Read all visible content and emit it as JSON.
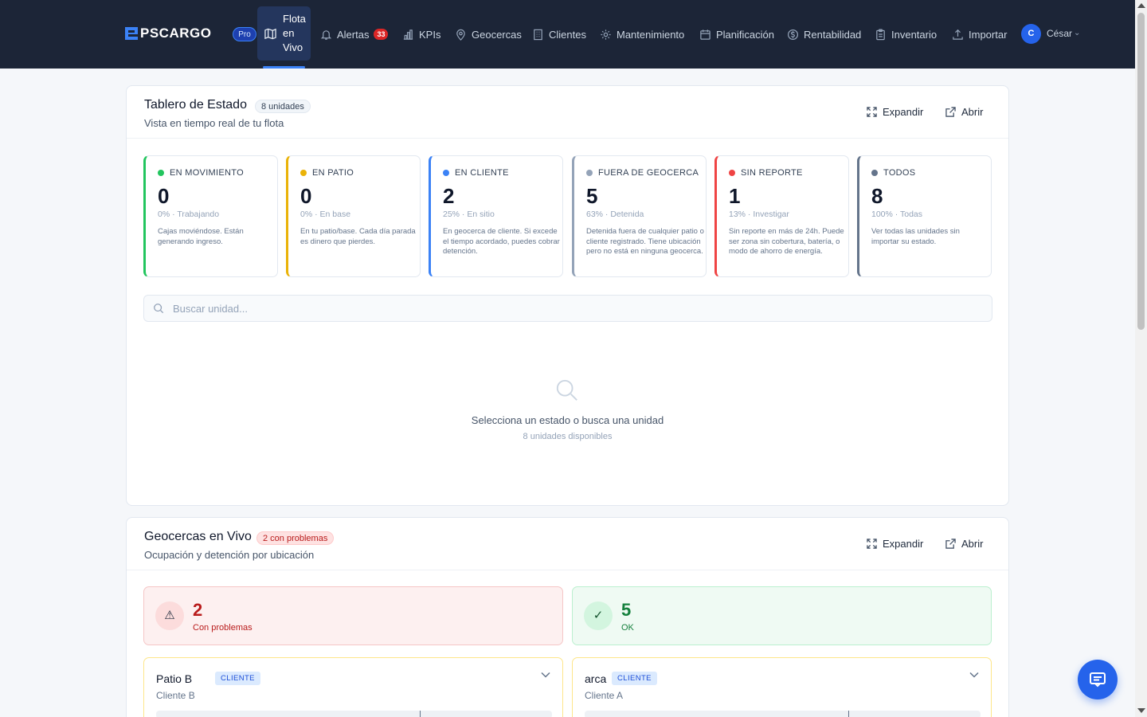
{
  "nav": {
    "logo": "PSCARGO",
    "plan_badge": "Pro",
    "active_item": "Flota en Vivo",
    "active_item_lines": [
      "Flota",
      "en",
      "Vivo"
    ],
    "items": [
      {
        "label": "Alertas",
        "icon": "bell-icon",
        "badge": "33"
      },
      {
        "label": "KPIs",
        "icon": "bar-chart-icon"
      },
      {
        "label": "Geocercas",
        "icon": "map-pin-icon"
      },
      {
        "label": "Clientes",
        "icon": "building-icon"
      },
      {
        "label": "Mantenimiento",
        "icon": "gear-icon"
      },
      {
        "label": "Planificación",
        "icon": "calendar-icon"
      },
      {
        "label": "Rentabilidad",
        "icon": "dollar-icon"
      },
      {
        "label": "Inventario",
        "icon": "clipboard-icon"
      },
      {
        "label": "Importar",
        "icon": "upload-icon"
      }
    ],
    "user": {
      "initial": "C",
      "name": "César"
    }
  },
  "status_board": {
    "title": "Tablero de Estado",
    "units_chip": "8 unidades",
    "subtitle": "Vista en tiempo real de tu flota",
    "expand_label": "Expandir",
    "open_label": "Abrir",
    "cards": [
      {
        "label": "EN MOVIMIENTO",
        "count": "0",
        "pct": "0% · Trabajando",
        "desc": "Cajas moviéndose. Están generando ingreso.",
        "color": "#22c55e"
      },
      {
        "label": "EN PATIO",
        "count": "0",
        "pct": "0% · En base",
        "desc": "En tu patio/base. Cada día parada es dinero que pierdes.",
        "color": "#eab308"
      },
      {
        "label": "EN CLIENTE",
        "count": "2",
        "pct": "25% · En sitio",
        "desc": "En geocerca de cliente. Si excede el tiempo acordado, puedes cobrar detención.",
        "color": "#3b82f6"
      },
      {
        "label": "FUERA DE GEOCERCA",
        "count": "5",
        "pct": "63% · Detenida",
        "desc": "Detenida fuera de cualquier patio o cliente registrado. Tiene ubicación pero no está en ninguna geocerca.",
        "color": "#94a3b8"
      },
      {
        "label": "SIN REPORTE",
        "count": "1",
        "pct": "13% · Investigar",
        "desc": "Sin reporte en más de 24h. Puede ser zona sin cobertura, batería, o modo de ahorro de energía.",
        "color": "#ef4444"
      },
      {
        "label": "TODOS",
        "count": "8",
        "pct": "100% · Todas",
        "desc": "Ver todas las unidades sin importar su estado.",
        "color": "#64748b"
      }
    ],
    "search_placeholder": "Buscar unidad...",
    "empty_title": "Selecciona un estado o busca una unidad",
    "empty_sub": "8 unidades disponibles"
  },
  "geofences": {
    "title": "Geocercas en Vivo",
    "problems_chip": "2 con problemas",
    "subtitle": "Ocupación y detención por ubicación",
    "expand_label": "Expandir",
    "open_label": "Abrir",
    "problems_count": "2",
    "problems_label": "Con problemas",
    "ok_count": "5",
    "ok_label": "OK",
    "cards": [
      {
        "name": "Patio B",
        "tag": "CLIENTE",
        "client": "Cliente B"
      },
      {
        "name": "arca",
        "tag": "CLIENTE",
        "client": "Cliente A"
      }
    ]
  }
}
